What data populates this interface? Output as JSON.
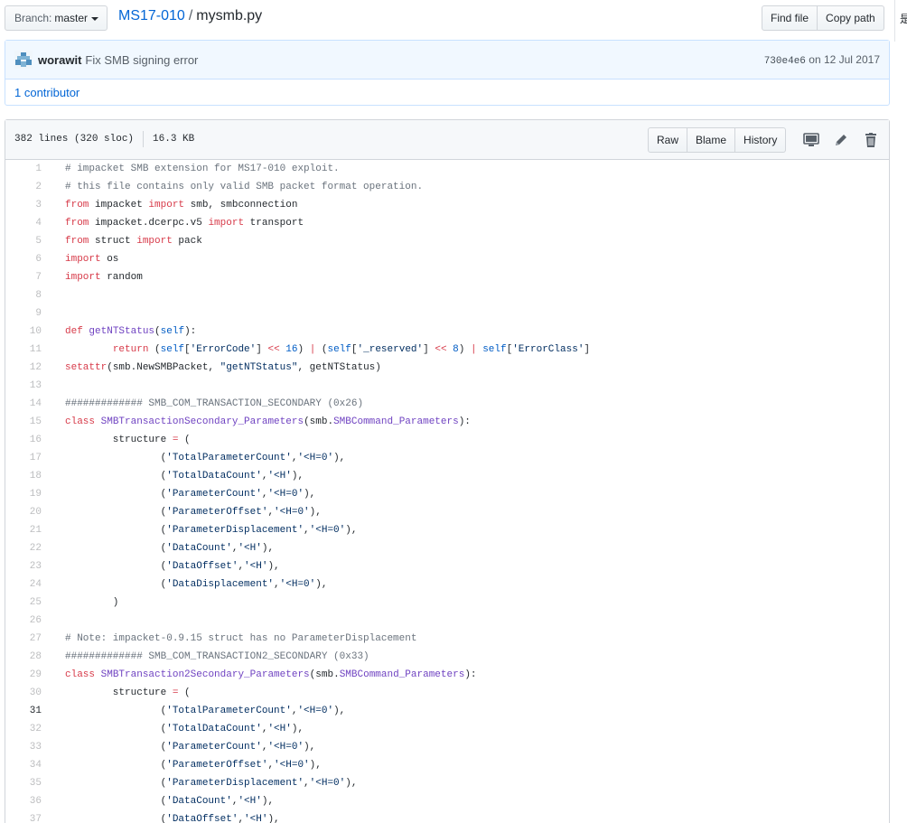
{
  "header": {
    "branch_label": "Branch:",
    "branch_name": "master",
    "repo": "MS17-010",
    "separator": "/",
    "file": "mysmb.py",
    "find_file": "Find file",
    "copy_path": "Copy path",
    "edge_glyph": "是"
  },
  "commit": {
    "author": "worawit",
    "message": "Fix SMB signing error",
    "sha": "730e4e6",
    "date_text": "on 12 Jul 2017",
    "contributors": "1 contributor"
  },
  "file": {
    "lines": "382 lines (320 sloc)",
    "size": "16.3 KB",
    "raw": "Raw",
    "blame": "Blame",
    "history": "History"
  },
  "code": [
    "# impacket SMB extension for MS17-010 exploit.",
    "# this file contains only valid SMB packet format operation.",
    "from impacket import smb, smbconnection",
    "from impacket.dcerpc.v5 import transport",
    "from struct import pack",
    "import os",
    "import random",
    "",
    "",
    "def getNTStatus(self):",
    "\treturn (self['ErrorCode'] << 16) | (self['_reserved'] << 8) | self['ErrorClass']",
    "setattr(smb.NewSMBPacket, \"getNTStatus\", getNTStatus)",
    "",
    "############# SMB_COM_TRANSACTION_SECONDARY (0x26)",
    "class SMBTransactionSecondary_Parameters(smb.SMBCommand_Parameters):",
    "\tstructure = (",
    "\t\t('TotalParameterCount','<H=0'),",
    "\t\t('TotalDataCount','<H'),",
    "\t\t('ParameterCount','<H=0'),",
    "\t\t('ParameterOffset','<H=0'),",
    "\t\t('ParameterDisplacement','<H=0'),",
    "\t\t('DataCount','<H'),",
    "\t\t('DataOffset','<H'),",
    "\t\t('DataDisplacement','<H=0'),",
    "\t)",
    "",
    "# Note: impacket-0.9.15 struct has no ParameterDisplacement",
    "############# SMB_COM_TRANSACTION2_SECONDARY (0x33)",
    "class SMBTransaction2Secondary_Parameters(smb.SMBCommand_Parameters):",
    "\tstructure = (",
    "\t\t('TotalParameterCount','<H=0'),",
    "\t\t('TotalDataCount','<H'),",
    "\t\t('ParameterCount','<H=0'),",
    "\t\t('ParameterOffset','<H=0'),",
    "\t\t('ParameterDisplacement','<H=0'),",
    "\t\t('DataCount','<H'),",
    "\t\t('DataOffset','<H'),"
  ],
  "highlighted_line": 31
}
